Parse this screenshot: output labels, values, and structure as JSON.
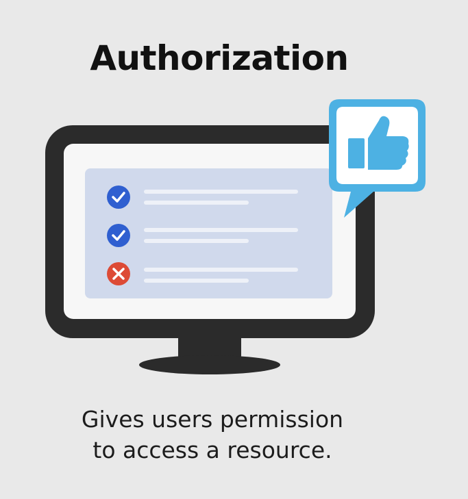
{
  "title": "Authorization",
  "caption": {
    "line1": "Gives users permission",
    "line2": "to access a resource."
  },
  "icons": {
    "monitor": "monitor-icon",
    "approved": "checkmark-circle-icon",
    "denied": "x-circle-icon",
    "feedback": "thumbs-up-icon"
  },
  "checklist": [
    {
      "status": "approved"
    },
    {
      "status": "approved"
    },
    {
      "status": "denied"
    }
  ],
  "colors": {
    "background": "#e9e9e9",
    "monitor_frame": "#2b2b2b",
    "screen_panel": "#d0d9ec",
    "approved": "#2f5fd0",
    "denied": "#dd4b36",
    "thumbs_up": "#4db1e3"
  }
}
